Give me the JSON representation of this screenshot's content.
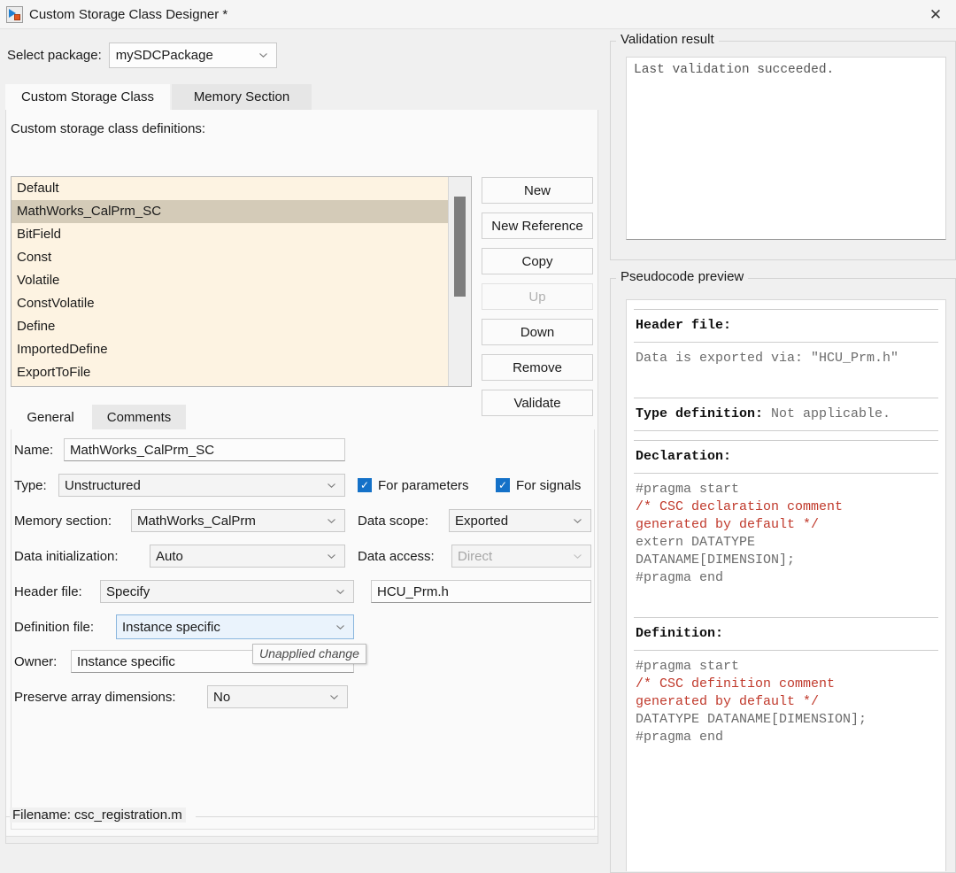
{
  "window": {
    "title": "Custom Storage Class Designer *",
    "app_icon": "custom-storage-class-designer-icon",
    "close_icon": "✕"
  },
  "package": {
    "label": "Select package:",
    "value": "mySDCPackage"
  },
  "tabs": [
    {
      "label": "Custom Storage Class",
      "active": true
    },
    {
      "label": "Memory Section",
      "active": false
    }
  ],
  "definitions": {
    "label": "Custom storage class definitions:",
    "items": [
      "Default",
      "MathWorks_CalPrm_SC",
      "BitField",
      "Const",
      "Volatile",
      "ConstVolatile",
      "Define",
      "ImportedDefine",
      "ExportToFile"
    ],
    "selected": "MathWorks_CalPrm_SC"
  },
  "buttons": [
    {
      "label": "New",
      "enabled": true
    },
    {
      "label": "New Reference",
      "enabled": true
    },
    {
      "label": "Copy",
      "enabled": true
    },
    {
      "label": "Up",
      "enabled": false
    },
    {
      "label": "Down",
      "enabled": true
    },
    {
      "label": "Remove",
      "enabled": true
    },
    {
      "label": "Validate",
      "enabled": true
    }
  ],
  "inner_tabs": [
    {
      "label": "General",
      "active": true
    },
    {
      "label": "Comments",
      "active": false
    }
  ],
  "form": {
    "name_label": "Name:",
    "name_value": "MathWorks_CalPrm_SC",
    "type_label": "Type:",
    "type_value": "Unstructured",
    "for_parameters_label": "For parameters",
    "for_parameters_checked": true,
    "for_signals_label": "For signals",
    "for_signals_checked": true,
    "memory_section_label": "Memory section:",
    "memory_section_value": "MathWorks_CalPrm",
    "data_scope_label": "Data scope:",
    "data_scope_value": "Exported",
    "data_initialization_label": "Data initialization:",
    "data_initialization_value": "Auto",
    "data_access_label": "Data access:",
    "data_access_value": "Direct",
    "header_file_label": "Header file:",
    "header_file_value": "Specify",
    "header_file_name": "HCU_Prm.h",
    "definition_file_label": "Definition file:",
    "definition_file_value": "Instance specific",
    "owner_label": "Owner:",
    "owner_value": "Instance specific",
    "preserve_array_label": "Preserve array dimensions:",
    "preserve_array_value": "No"
  },
  "tooltip": {
    "text": "Unapplied change"
  },
  "filename": {
    "text": "Filename: csc_registration.m"
  },
  "validation": {
    "legend": "Validation result",
    "text": "Last validation succeeded."
  },
  "pseudocode": {
    "legend": "Pseudocode preview",
    "header_file_title": "Header file:",
    "header_file_body": "Data is exported via: \"HCU_Prm.h\"",
    "type_definition_title": "Type definition:",
    "type_definition_value": " Not applicable.",
    "declaration_title": "Declaration:",
    "declaration_line1": "#pragma start",
    "declaration_comment": "/* CSC declaration comment\ngenerated by default */",
    "declaration_line2": "extern DATATYPE\nDATANAME[DIMENSION];\n#pragma end",
    "definition_title": "Definition:",
    "definition_line1": "#pragma start",
    "definition_comment": "/* CSC definition comment\ngenerated by default */",
    "definition_line2": "DATATYPE DATANAME[DIMENSION];\n#pragma end"
  },
  "colors": {
    "accent": "#1471c8",
    "list_background": "#fdf3e2",
    "list_selection": "#d4cbb8",
    "comment_red": "#c0392b",
    "window_background": "#f0f0f0"
  }
}
